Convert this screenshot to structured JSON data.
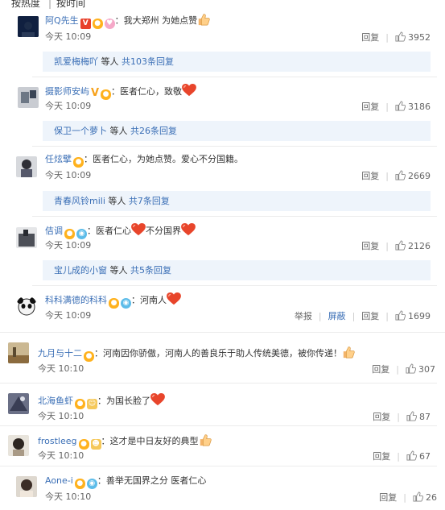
{
  "tabs": {
    "hot": "按热度",
    "time": "按时间"
  },
  "comments": [
    {
      "user": "阿Q先生",
      "text": "：我大郑州 为她点赞",
      "time": "今天 10:09",
      "reply": "回复",
      "likes": "3952",
      "replies_user": "凯爱梅梅吖",
      "replies_mid": "等人",
      "replies_count": "共103条回复"
    },
    {
      "user": "摄影师安屿",
      "text": "：医者仁心，致敬",
      "time": "今天 10:09",
      "reply": "回复",
      "likes": "3186",
      "replies_user": "保卫一个萝卜",
      "replies_mid": "等人",
      "replies_count": "共26条回复"
    },
    {
      "user": "任炫擘",
      "text": "：医者仁心，为她点赞。爱心不分国籍。",
      "time": "今天 10:09",
      "reply": "回复",
      "likes": "2669",
      "replies_user": "青春风铃mili",
      "replies_mid": "等人",
      "replies_count": "共7条回复"
    },
    {
      "user": "佶调",
      "text_a": "：医者仁心",
      "text_b": "不分国界",
      "time": "今天 10:09",
      "reply": "回复",
      "likes": "2126",
      "replies_user": "宝儿成的小窗",
      "replies_mid": "等人",
      "replies_count": "共5条回复"
    },
    {
      "user": "科科满德的科科",
      "text": "：河南人",
      "time": "今天 10:09",
      "report": "举报",
      "block": "屏蔽",
      "reply": "回复",
      "likes": "1699"
    },
    {
      "user": "九月与十二",
      "text": "：河南因你骄傲，河南人的善良乐于助人传统美德，被你传递！",
      "time": "今天 10:10",
      "reply": "回复",
      "likes": "307"
    },
    {
      "user": "北海鱼虾",
      "text": "：为国长脸了",
      "time": "今天 10:10",
      "reply": "回复",
      "likes": "87"
    },
    {
      "user": "frostleeg",
      "text": "：这才是中日友好的典型",
      "time": "今天 10:10",
      "reply": "回复",
      "likes": "67"
    },
    {
      "user": "Aone-i",
      "text": "：善举无国界之分 医者仁心",
      "time": "今天 10:10",
      "reply": "回复",
      "likes": "26"
    }
  ]
}
